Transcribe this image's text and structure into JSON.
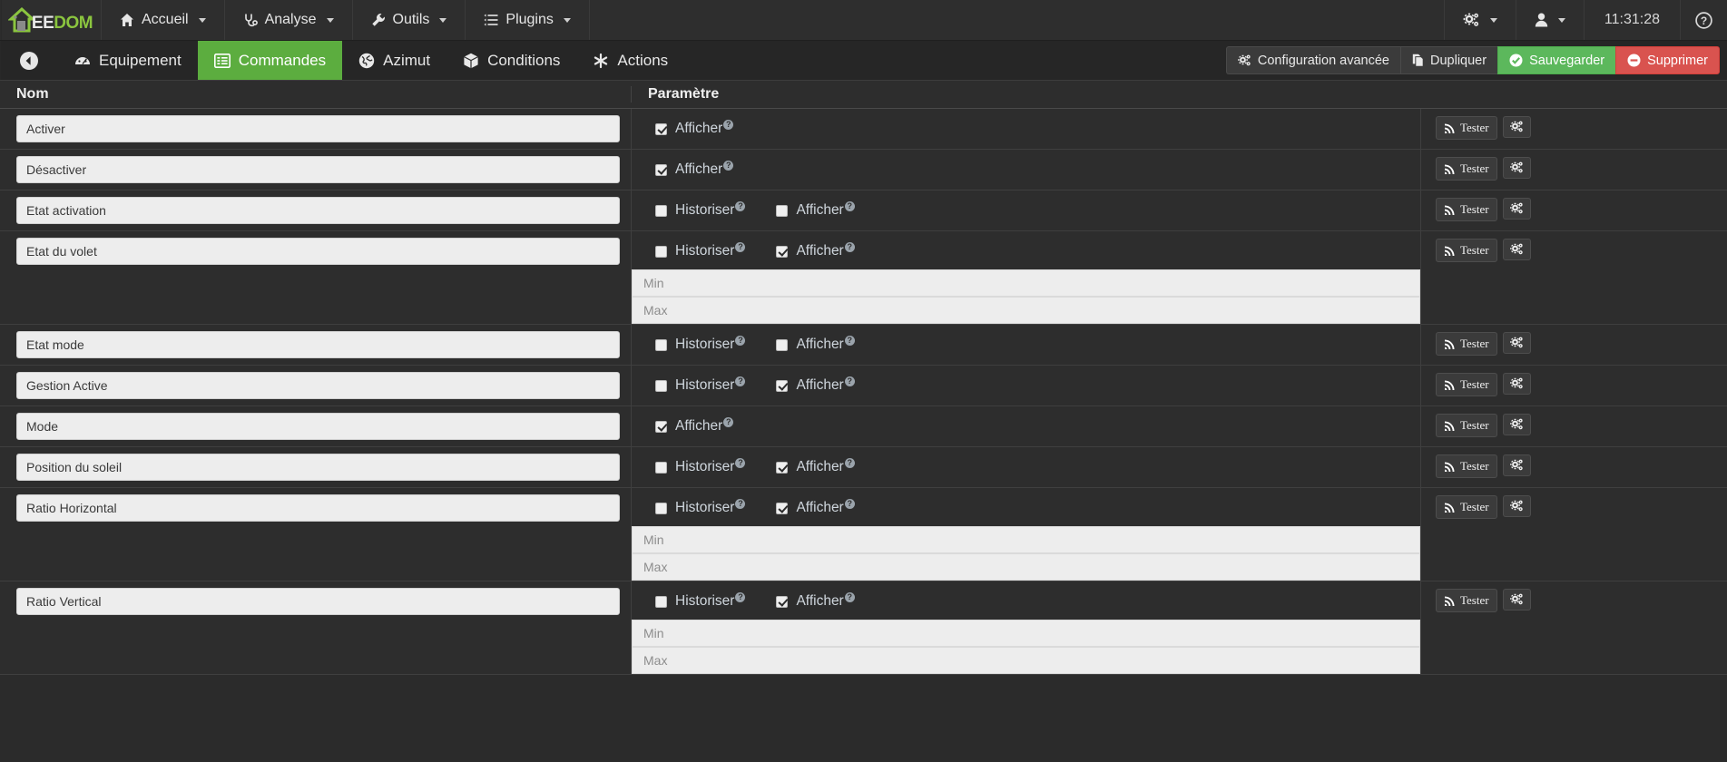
{
  "brand": {
    "ee": "EE",
    "dom": "DOM"
  },
  "topnav": {
    "items": [
      {
        "label": "Accueil",
        "icon": "home-icon",
        "caret": true
      },
      {
        "label": "Analyse",
        "icon": "stethoscope-icon",
        "caret": true
      },
      {
        "label": "Outils",
        "icon": "wrench-icon",
        "caret": true
      },
      {
        "label": "Plugins",
        "icon": "list-icon",
        "caret": true
      }
    ],
    "right": {
      "gear_label": "",
      "user_label": "",
      "clock": "11:31:28",
      "help": "?"
    }
  },
  "tabs": {
    "back": "back-arrow",
    "items": [
      {
        "label": "Equipement",
        "icon": "dashboard-icon",
        "active": false
      },
      {
        "label": "Commandes",
        "icon": "list-alt-icon",
        "active": true
      },
      {
        "label": "Azimut",
        "icon": "globe-icon",
        "active": false
      },
      {
        "label": "Conditions",
        "icon": "cube-icon",
        "active": false
      },
      {
        "label": "Actions",
        "icon": "asterisk-icon",
        "active": false
      }
    ],
    "actions": [
      {
        "label": "Configuration avancée",
        "icon": "cogs-icon",
        "style": "default"
      },
      {
        "label": "Dupliquer",
        "icon": "copy-icon",
        "style": "default"
      },
      {
        "label": "Sauvegarder",
        "icon": "check-circle-icon",
        "style": "green"
      },
      {
        "label": "Supprimer",
        "icon": "minus-circle-icon",
        "style": "red"
      }
    ]
  },
  "table": {
    "headers": {
      "nom": "Nom",
      "parametre": "Paramètre",
      "actions": ""
    },
    "labels": {
      "historiser": "Historiser",
      "afficher": "Afficher",
      "min_placeholder": "Min",
      "max_placeholder": "Max",
      "tester": "Tester",
      "help": "?"
    },
    "rows": [
      {
        "nom": "Activer",
        "historiser": null,
        "afficher": true,
        "minmax": false
      },
      {
        "nom": "Désactiver",
        "historiser": null,
        "afficher": true,
        "minmax": false
      },
      {
        "nom": "Etat activation",
        "historiser": false,
        "afficher": false,
        "minmax": false
      },
      {
        "nom": "Etat du volet",
        "historiser": false,
        "afficher": true,
        "minmax": true
      },
      {
        "nom": "Etat mode",
        "historiser": false,
        "afficher": false,
        "minmax": false
      },
      {
        "nom": "Gestion Active",
        "historiser": false,
        "afficher": true,
        "minmax": false
      },
      {
        "nom": "Mode",
        "historiser": null,
        "afficher": true,
        "minmax": false
      },
      {
        "nom": "Position du soleil",
        "historiser": false,
        "afficher": true,
        "minmax": false
      },
      {
        "nom": "Ratio Horizontal",
        "historiser": false,
        "afficher": true,
        "minmax": true
      },
      {
        "nom": "Ratio Vertical",
        "historiser": false,
        "afficher": true,
        "minmax": true
      }
    ]
  },
  "colors": {
    "accent_green": "#5cad3f",
    "save_green": "#5cb85c",
    "delete_red": "#d9534f",
    "brand_green": "#8bc53f",
    "page_bg": "#2b2b2b"
  }
}
